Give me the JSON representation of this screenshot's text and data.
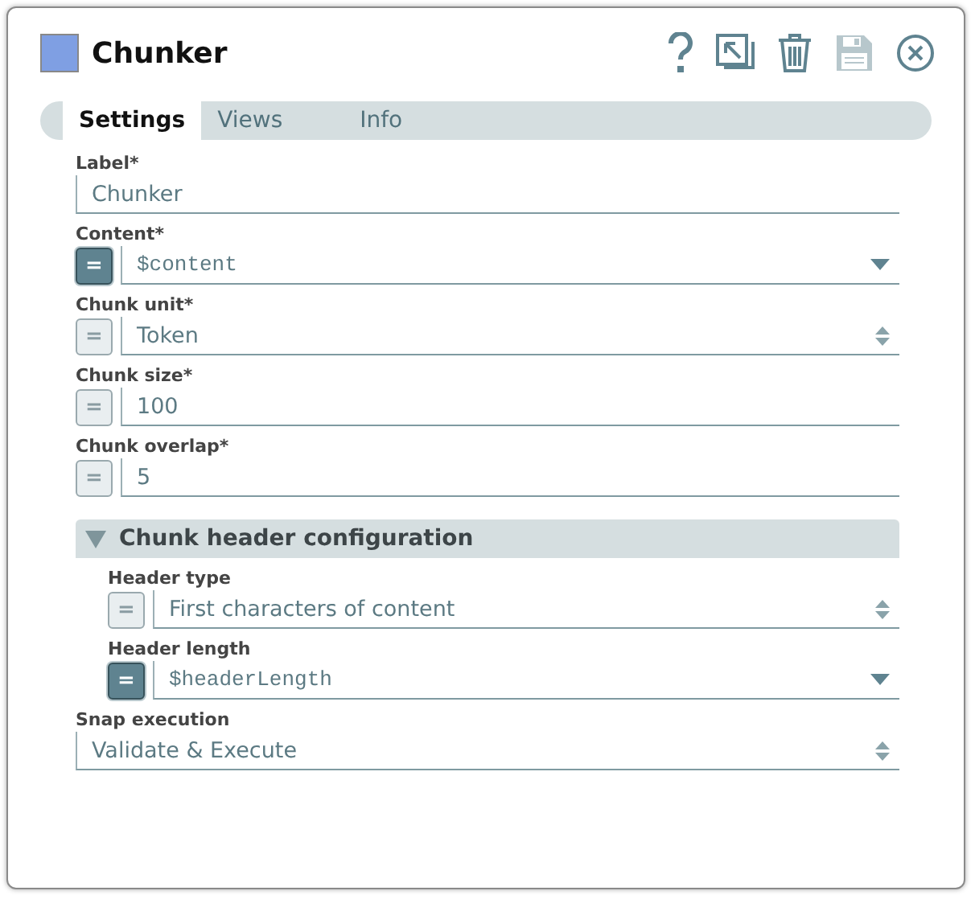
{
  "window": {
    "title": "Chunker"
  },
  "toolbar": [
    {
      "kind": "help",
      "disabled": false
    },
    {
      "kind": "export",
      "disabled": false
    },
    {
      "kind": "delete",
      "disabled": false
    },
    {
      "kind": "save",
      "disabled": true
    },
    {
      "kind": "close",
      "disabled": false
    }
  ],
  "tabs": [
    {
      "label": "Settings",
      "selected": true
    },
    {
      "label": "Views",
      "selected": false
    },
    {
      "label": "Info",
      "selected": false
    }
  ],
  "fields": [
    {
      "label": "Label*",
      "kind": "text",
      "value": "Chunker"
    },
    {
      "label": "Content*",
      "kind": "suggest",
      "expression": {
        "text": "=",
        "on": true
      },
      "value": "$content"
    },
    {
      "label": "Chunk unit*",
      "kind": "select",
      "expression": {
        "text": "=",
        "on": false
      },
      "value": "Token"
    },
    {
      "label": "Chunk size*",
      "kind": "text",
      "expression": {
        "text": "=",
        "on": false
      },
      "value": "100"
    },
    {
      "label": "Chunk overlap*",
      "kind": "text",
      "expression": {
        "text": "=",
        "on": false
      },
      "value": "5"
    }
  ],
  "section": {
    "title": "Chunk header configuration",
    "expanded": true,
    "fields": [
      {
        "label": "Header type",
        "kind": "select",
        "expression": {
          "text": "=",
          "on": false
        },
        "value": "First characters of content"
      },
      {
        "label": "Header length",
        "kind": "suggest",
        "expression": {
          "text": "=",
          "on": true
        },
        "value": "$headerLength"
      }
    ]
  },
  "after_fields": [
    {
      "label": "Snap execution",
      "kind": "select",
      "value": "Validate & Execute"
    }
  ]
}
